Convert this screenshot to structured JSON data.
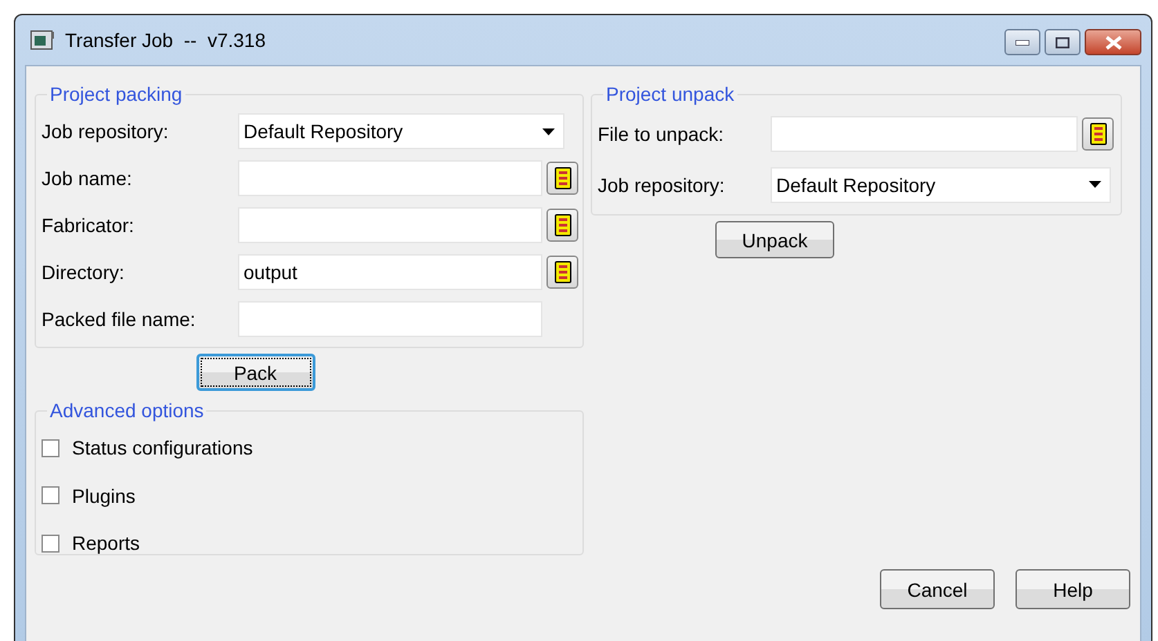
{
  "window": {
    "title": "Transfer Job  --  v7.318"
  },
  "packing": {
    "title": "Project packing",
    "fields": [
      {
        "kind": "combo",
        "label": "Job repository:",
        "value": "Default Repository"
      },
      {
        "kind": "browse",
        "label": "Job name:"
      },
      {
        "kind": "browse",
        "label": "Fabricator:"
      },
      {
        "kind": "browse",
        "label": "Directory:",
        "value": "output"
      },
      {
        "kind": "text",
        "label": "Packed file name:"
      }
    ],
    "button": {
      "label": "Pack",
      "focused": true
    }
  },
  "advanced": {
    "title": "Advanced options",
    "options": [
      {
        "label": "Status configurations",
        "checked": false
      },
      {
        "label": "Plugins",
        "checked": false
      },
      {
        "label": "Reports",
        "checked": false
      }
    ]
  },
  "unpack": {
    "title": "Project unpack",
    "fields": [
      {
        "kind": "browse",
        "label": "File to unpack:"
      },
      {
        "kind": "combo",
        "label": "Job repository:",
        "value": "Default Repository"
      }
    ],
    "button": {
      "label": "Unpack",
      "focused": false
    }
  },
  "buttons": [
    {
      "label": "Cancel",
      "focused": false
    },
    {
      "label": "Help",
      "focused": false
    }
  ]
}
